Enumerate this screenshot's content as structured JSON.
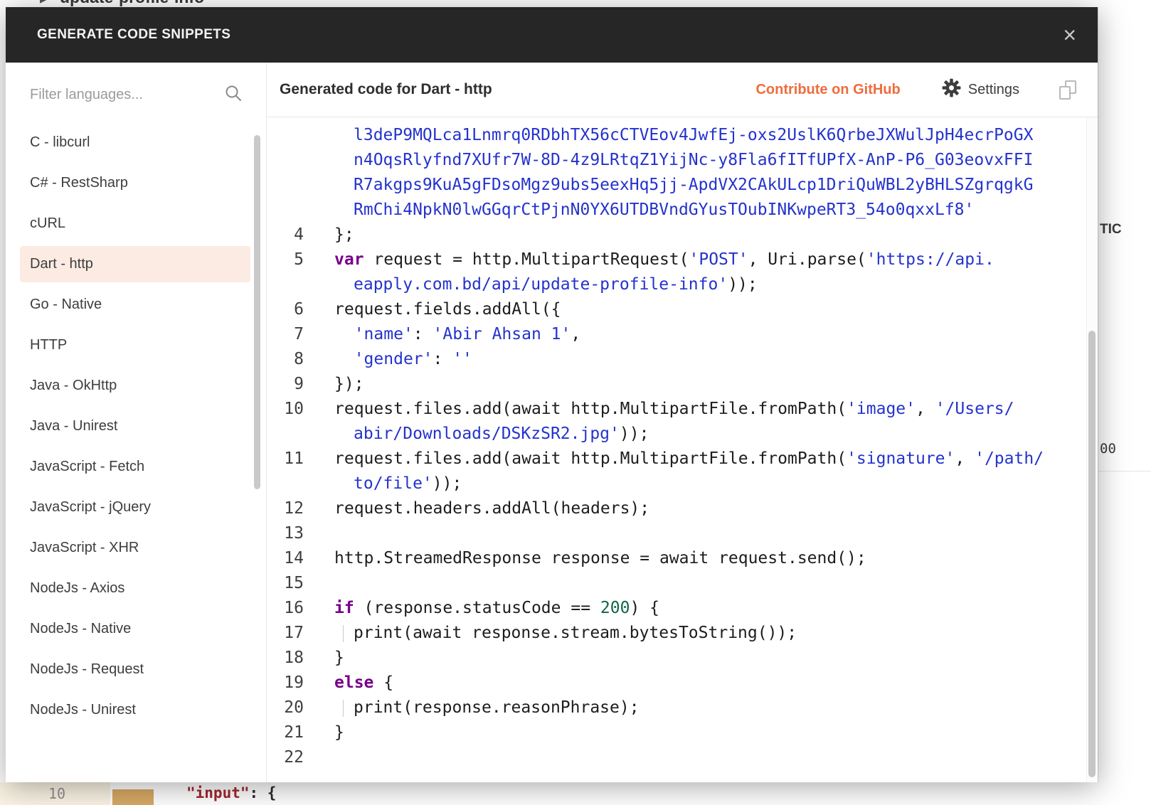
{
  "modal": {
    "title": "GENERATE CODE SNIPPETS",
    "close_glyph": "×"
  },
  "sidebar": {
    "filter_placeholder": "Filter languages...",
    "selected": "Dart - http",
    "languages": [
      "C - libcurl",
      "C# - RestSharp",
      "cURL",
      "Dart - http",
      "Go - Native",
      "HTTP",
      "Java - OkHttp",
      "Java - Unirest",
      "JavaScript - Fetch",
      "JavaScript - jQuery",
      "JavaScript - XHR",
      "NodeJs - Axios",
      "NodeJs - Native",
      "NodeJs - Request",
      "NodeJs - Unirest"
    ]
  },
  "main_header": {
    "title": "Generated code for Dart - http",
    "contribute_label": "Contribute on GitHub",
    "settings_label": "Settings"
  },
  "colors": {
    "header_bg": "#262626",
    "accent_orange": "#ff6c37",
    "selected_language_bg": "#fcebe2",
    "code_string": "#2433cc",
    "code_keyword": "#770088",
    "code_number": "#116644"
  },
  "code": {
    "rows": [
      {
        "num": "",
        "wrap": true,
        "segs": [
          {
            "t": "string",
            "v": "l3deP9MQLca1Lnmrq0RDbhTX56cCTVEov4JwfEj-oxs2UslK6QrbeJXWulJpH4ecrPoGX"
          }
        ]
      },
      {
        "num": "",
        "wrap": true,
        "segs": [
          {
            "t": "string",
            "v": "n4OqsRlyfnd7XUfr7W-8D-4z9LRtqZ1YijNc-y8Fla6fITfUPfX-AnP-P6_G03eovxFFI"
          }
        ]
      },
      {
        "num": "",
        "wrap": true,
        "segs": [
          {
            "t": "string",
            "v": "R7akgps9KuA5gFDsoMgz9ubs5eexHq5jj-ApdVX2CAkULcp1DriQuWBL2yBHLSZgrqgkG"
          }
        ]
      },
      {
        "num": "",
        "wrap": true,
        "segs": [
          {
            "t": "string",
            "v": "RmChi4NpkN0lwGGqrCtPjnN0YX6UTDBVndGYusTOubINKwpeRT3_54o0qxxLf8'"
          }
        ]
      },
      {
        "num": "4",
        "segs": [
          {
            "t": "plain",
            "v": "};"
          }
        ]
      },
      {
        "num": "5",
        "segs": [
          {
            "t": "keyword",
            "v": "var"
          },
          {
            "t": "plain",
            "v": " request = http.MultipartRequest("
          },
          {
            "t": "string",
            "v": "'POST'"
          },
          {
            "t": "plain",
            "v": ", Uri.parse("
          },
          {
            "t": "string",
            "v": "'https://api."
          }
        ]
      },
      {
        "num": "",
        "wrap": true,
        "segs": [
          {
            "t": "string",
            "v": "eapply.com.bd/api/update-profile-info'"
          },
          {
            "t": "plain",
            "v": "));"
          }
        ]
      },
      {
        "num": "6",
        "segs": [
          {
            "t": "plain",
            "v": "request.fields.addAll({"
          }
        ]
      },
      {
        "num": "7",
        "segs": [
          {
            "t": "plain",
            "v": "  "
          },
          {
            "t": "string",
            "v": "'name'"
          },
          {
            "t": "plain",
            "v": ": "
          },
          {
            "t": "string",
            "v": "'Abir Ahsan 1'"
          },
          {
            "t": "plain",
            "v": ","
          }
        ]
      },
      {
        "num": "8",
        "segs": [
          {
            "t": "plain",
            "v": "  "
          },
          {
            "t": "string",
            "v": "'gender'"
          },
          {
            "t": "plain",
            "v": ": "
          },
          {
            "t": "string",
            "v": "''"
          }
        ]
      },
      {
        "num": "9",
        "segs": [
          {
            "t": "plain",
            "v": "});"
          }
        ]
      },
      {
        "num": "10",
        "segs": [
          {
            "t": "plain",
            "v": "request.files.add(await http.MultipartFile.fromPath("
          },
          {
            "t": "string",
            "v": "'image'"
          },
          {
            "t": "plain",
            "v": ", "
          },
          {
            "t": "string",
            "v": "'/Users/"
          }
        ]
      },
      {
        "num": "",
        "wrap": true,
        "segs": [
          {
            "t": "string",
            "v": "abir/Downloads/DSKzSR2.jpg'"
          },
          {
            "t": "plain",
            "v": "));"
          }
        ]
      },
      {
        "num": "11",
        "segs": [
          {
            "t": "plain",
            "v": "request.files.add(await http.MultipartFile.fromPath("
          },
          {
            "t": "string",
            "v": "'signature'"
          },
          {
            "t": "plain",
            "v": ", "
          },
          {
            "t": "string",
            "v": "'/path/"
          }
        ]
      },
      {
        "num": "",
        "wrap": true,
        "segs": [
          {
            "t": "string",
            "v": "to/file'"
          },
          {
            "t": "plain",
            "v": "));"
          }
        ]
      },
      {
        "num": "12",
        "segs": [
          {
            "t": "plain",
            "v": "request.headers.addAll(headers);"
          }
        ]
      },
      {
        "num": "13",
        "segs": []
      },
      {
        "num": "14",
        "segs": [
          {
            "t": "plain",
            "v": "http.StreamedResponse response = await request.send();"
          }
        ]
      },
      {
        "num": "15",
        "segs": []
      },
      {
        "num": "16",
        "segs": [
          {
            "t": "keyword",
            "v": "if"
          },
          {
            "t": "plain",
            "v": " (response.statusCode == "
          },
          {
            "t": "number",
            "v": "200"
          },
          {
            "t": "plain",
            "v": ") {"
          }
        ]
      },
      {
        "num": "17",
        "segs": [
          {
            "t": "guide"
          },
          {
            "t": "plain",
            "v": "print(await response.stream.bytesToString());"
          }
        ]
      },
      {
        "num": "18",
        "segs": [
          {
            "t": "plain",
            "v": "}"
          }
        ]
      },
      {
        "num": "19",
        "segs": [
          {
            "t": "keyword",
            "v": "else"
          },
          {
            "t": "plain",
            "v": " {"
          }
        ]
      },
      {
        "num": "20",
        "segs": [
          {
            "t": "guide"
          },
          {
            "t": "plain",
            "v": "print(response.reasonPhrase);"
          }
        ]
      },
      {
        "num": "21",
        "segs": [
          {
            "t": "plain",
            "v": "}"
          }
        ]
      },
      {
        "num": "22",
        "segs": []
      }
    ]
  },
  "background_page": {
    "top_arrow": "▸",
    "top_text": "update-profile-info",
    "bottom_gutter_number": "10",
    "bottom_code_key": "\"input\"",
    "bottom_code_rest": ": {",
    "right_fragment_top": "TIC",
    "right_fragment_bottom": "00"
  }
}
